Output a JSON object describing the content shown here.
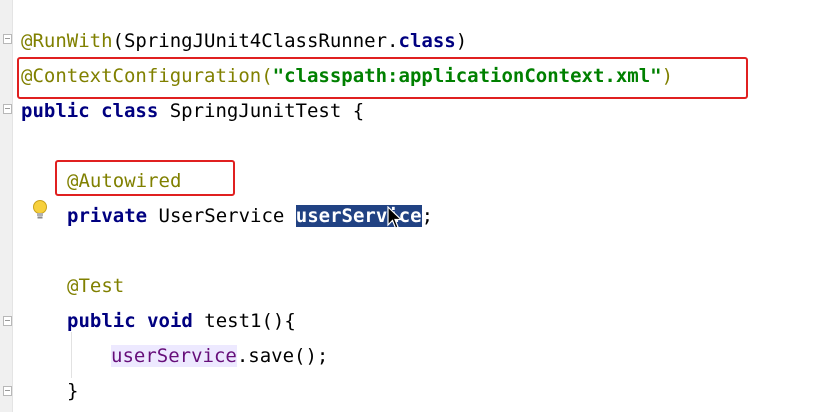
{
  "editor": {
    "lines": {
      "l1": {
        "anno": "@RunWith",
        "open": "(SpringJUnit4ClassRunner.",
        "kw": "class",
        "close": ")"
      },
      "l2": {
        "anno": "@ContextConfiguration(",
        "str": "\"classpath:applicationContext.xml\"",
        "close": ")"
      },
      "l3": {
        "kw": "public class",
        "rest": " SpringJunitTest {"
      },
      "l4": {
        "anno": "@Autowired"
      },
      "l5": {
        "kw": "private",
        "type": " UserService ",
        "selected": "userService",
        "end": ";"
      },
      "l6": {
        "anno": "@Test"
      },
      "l7": {
        "kw": "public void",
        "rest": " test1(){"
      },
      "l8": {
        "field": "userService",
        "rest": ".save();"
      },
      "l9": {
        "text": "}"
      }
    },
    "icons": {
      "bulb": "lightbulb-icon",
      "cursor": "mouse-pointer-icon"
    },
    "colors": {
      "annotation": "#808000",
      "keyword": "#000080",
      "string": "#008000",
      "field": "#660e7a",
      "selection": "#214283",
      "highlight_box": "#e02020"
    }
  }
}
